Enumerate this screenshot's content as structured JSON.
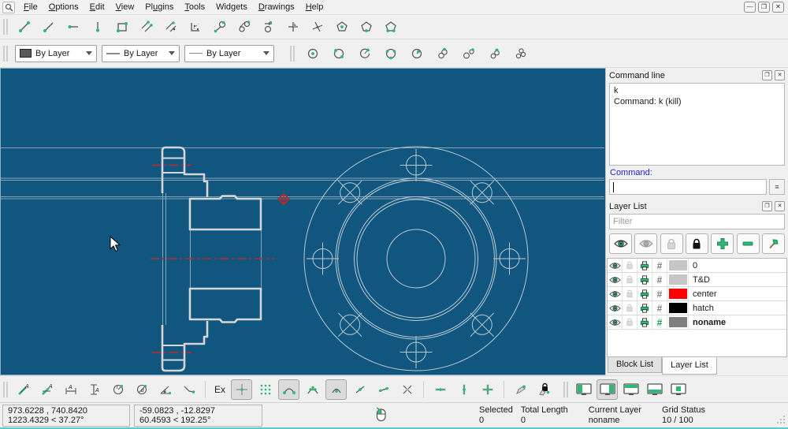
{
  "window": {
    "minimize_glyph": "—",
    "restore_glyph": "❐",
    "close_glyph": "✕"
  },
  "menubar": {
    "items": [
      {
        "pre": "",
        "u": "F",
        "post": "ile"
      },
      {
        "pre": "",
        "u": "O",
        "post": "ptions"
      },
      {
        "pre": "",
        "u": "E",
        "post": "dit"
      },
      {
        "pre": "",
        "u": "V",
        "post": "iew"
      },
      {
        "pre": "Pl",
        "u": "u",
        "post": "gins"
      },
      {
        "pre": "",
        "u": "T",
        "post": "ools"
      },
      {
        "pre": "Widgets",
        "u": "",
        "post": ""
      },
      {
        "pre": "",
        "u": "D",
        "post": "rawings"
      },
      {
        "pre": "",
        "u": "H",
        "post": "elp"
      }
    ]
  },
  "pen_toolbar": {
    "color_label": "By Layer",
    "width_label": "By Layer",
    "linetype_label": "By Layer"
  },
  "command_dock": {
    "title": "Command line",
    "history": [
      "k",
      "Command: k (kill)"
    ],
    "prompt_label": "Command:",
    "menu_glyph": "≡"
  },
  "layer_dock": {
    "title": "Layer List",
    "filter_placeholder": "Filter",
    "layers": [
      {
        "name": "0",
        "color": "#c6c6c6",
        "hash_color": "#7c7c7c",
        "bold": false
      },
      {
        "name": "T&D",
        "color": "#c6c6c6",
        "hash_color": "#7c7c7c",
        "bold": false
      },
      {
        "name": "center",
        "color": "#ff0000",
        "hash_color": "#7c7c7c",
        "bold": false
      },
      {
        "name": "hatch",
        "color": "#000000",
        "hash_color": "#7c7c7c",
        "bold": false
      },
      {
        "name": "noname",
        "color": "#7f7f7f",
        "hash_color": "#00a44e",
        "bold": true
      }
    ],
    "tabs": [
      "Block List",
      "Layer List"
    ]
  },
  "bottom_toolbar": {
    "exclusive_label": "Ex"
  },
  "statusbar": {
    "abs_line1": "973.6228 , 740.8420",
    "abs_line2": "1223.4329 < 37.27°",
    "rel_line1": "-59.0823 , -12.8297",
    "rel_line2": "60.4593 < 192.25°",
    "selected_label": "Selected",
    "total_length_label": "Total Length",
    "selected_value": "0",
    "total_length_value": "0",
    "current_layer_label": "Current Layer",
    "current_layer_value": "noname",
    "grid_label": "Grid Status",
    "grid_value": "10 / 100"
  },
  "canvas_colors": {
    "background": "#11567e",
    "outline": "#d6d6d6",
    "thin_line": "#87a4b6",
    "circle": "#b9c9d2",
    "centerline_red": "#c62626"
  }
}
